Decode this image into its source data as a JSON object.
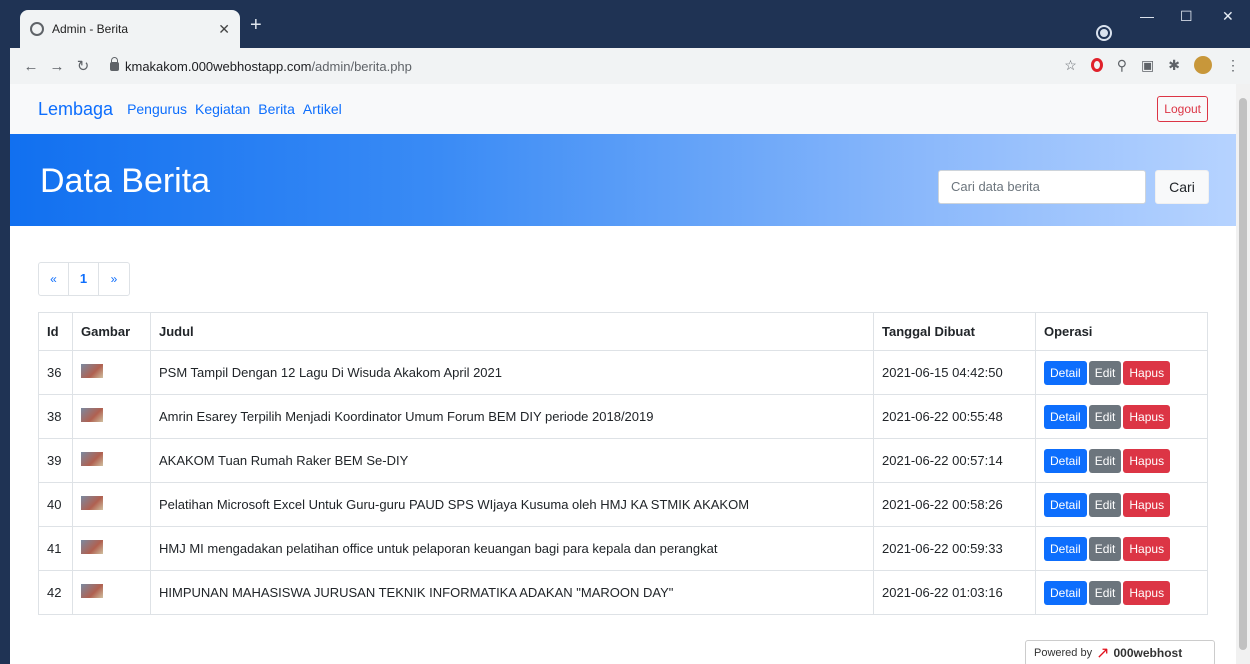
{
  "browser": {
    "tab_title": "Admin - Berita",
    "url_domain": "kmakakom.000webhostapp.com",
    "url_path": "/admin/berita.php"
  },
  "navbar": {
    "brand": "Lembaga",
    "links": [
      "Pengurus",
      "Kegiatan",
      "Berita",
      "Artikel"
    ],
    "logout": "Logout"
  },
  "hero": {
    "title": "Data Berita",
    "search_placeholder": "Cari data berita",
    "search_button": "Cari"
  },
  "pagination": {
    "prev": "«",
    "current": "1",
    "next": "»"
  },
  "table": {
    "headers": [
      "Id",
      "Gambar",
      "Judul",
      "Tanggal Dibuat",
      "Operasi"
    ],
    "rows": [
      {
        "id": "36",
        "judul": "PSM Tampil Dengan 12 Lagu Di Wisuda Akakom April 2021",
        "tanggal": "2021-06-15 04:42:50"
      },
      {
        "id": "38",
        "judul": "Amrin Esarey Terpilih Menjadi Koordinator Umum Forum BEM DIY periode 2018/2019",
        "tanggal": "2021-06-22 00:55:48"
      },
      {
        "id": "39",
        "judul": "AKAKOM Tuan Rumah Raker BEM Se-DIY",
        "tanggal": "2021-06-22 00:57:14"
      },
      {
        "id": "40",
        "judul": "Pelatihan Microsoft Excel Untuk Guru-guru PAUD SPS WIjaya Kusuma oleh HMJ KA STMIK AKAKOM",
        "tanggal": "2021-06-22 00:58:26"
      },
      {
        "id": "41",
        "judul": "HMJ MI mengadakan pelatihan office untuk pelaporan keuangan bagi para kepala dan perangkat",
        "tanggal": "2021-06-22 00:59:33"
      },
      {
        "id": "42",
        "judul": "HIMPUNAN MAHASISWA JURUSAN TEKNIK INFORMATIKA ADAKAN \"MAROON DAY\"",
        "tanggal": "2021-06-22 01:03:16"
      }
    ],
    "buttons": {
      "detail": "Detail",
      "edit": "Edit",
      "hapus": "Hapus"
    }
  },
  "footer": {
    "powered_by": "Powered by",
    "host": "000webhost"
  }
}
